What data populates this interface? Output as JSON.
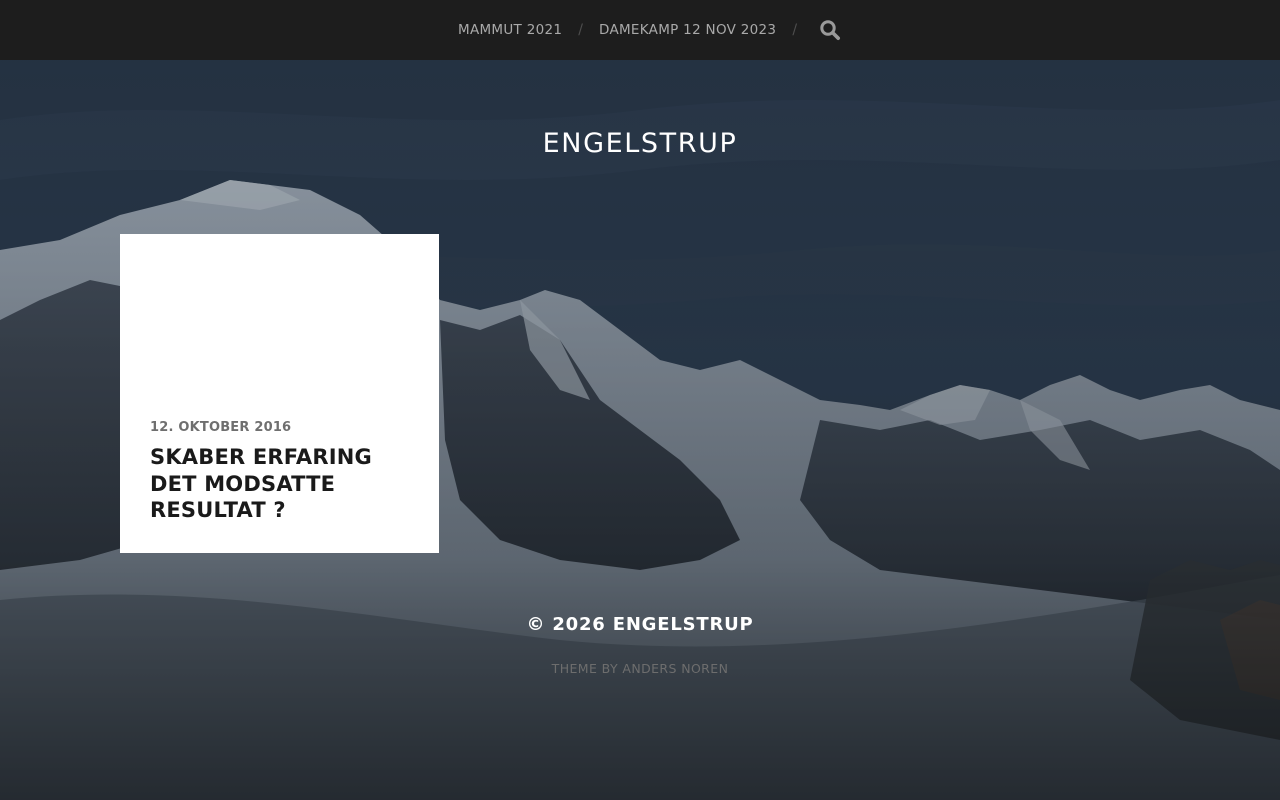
{
  "nav": {
    "items": [
      {
        "label": "MAMMUT 2021"
      },
      {
        "label": "DAMEKAMP 12 NOV 2023"
      }
    ],
    "separator": "/",
    "search_icon": "search-icon"
  },
  "site": {
    "title": "ENGELSTRUP"
  },
  "posts": [
    {
      "date": "12. OKTOBER 2016",
      "title": "SKABER ERFARING DET MODSATTE RESULTAT ?"
    }
  ],
  "footer": {
    "copyright_prefix": "© 2026",
    "site_link": "ENGELSTRUP",
    "theme_prefix": "THEME BY",
    "theme_author": "ANDERS NOREN"
  },
  "colors": {
    "nav_bg": "#1d1d1d",
    "nav_text": "#a9a9a9",
    "card_bg": "#ffffff",
    "title_text": "#ffffff",
    "sky": "#2a3a4c"
  }
}
